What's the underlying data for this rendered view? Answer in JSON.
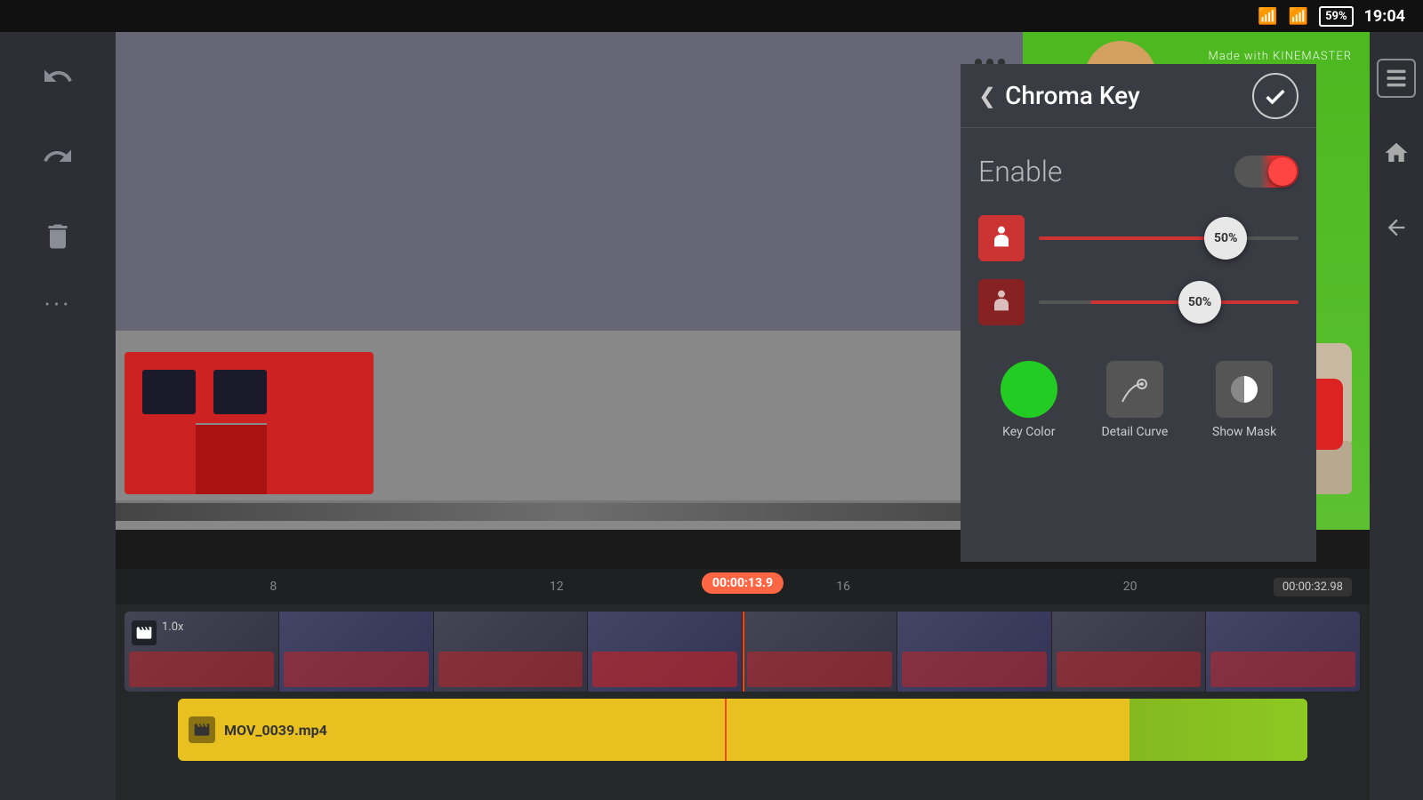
{
  "statusBar": {
    "battery": "59%",
    "time": "19:04"
  },
  "sidebar": {
    "undo_label": "Undo",
    "redo_label": "Redo",
    "delete_label": "Delete",
    "more_label": "More"
  },
  "rightSidebar": {
    "layers_label": "Layers",
    "home_label": "Home",
    "back_label": "Back"
  },
  "chromaPanel": {
    "title": "Chroma Key",
    "back_label": "<",
    "confirm_label": "✓",
    "enable_label": "Enable",
    "slider1_value": "50%",
    "slider2_value": "50%",
    "keyColor_label": "Key Color",
    "detailCurve_label": "Detail Curve",
    "showMask_label": "Show Mask"
  },
  "timeline": {
    "currentTime": "00:00:13.9",
    "totalTime": "00:00:32.98",
    "marks": [
      "8",
      "12",
      "16",
      "20"
    ],
    "speed": "1.0x",
    "overlayFile": "MOV_0039.mp4",
    "back_label": "‹"
  },
  "preview": {
    "watermark": "Made with KINEMASTER"
  }
}
